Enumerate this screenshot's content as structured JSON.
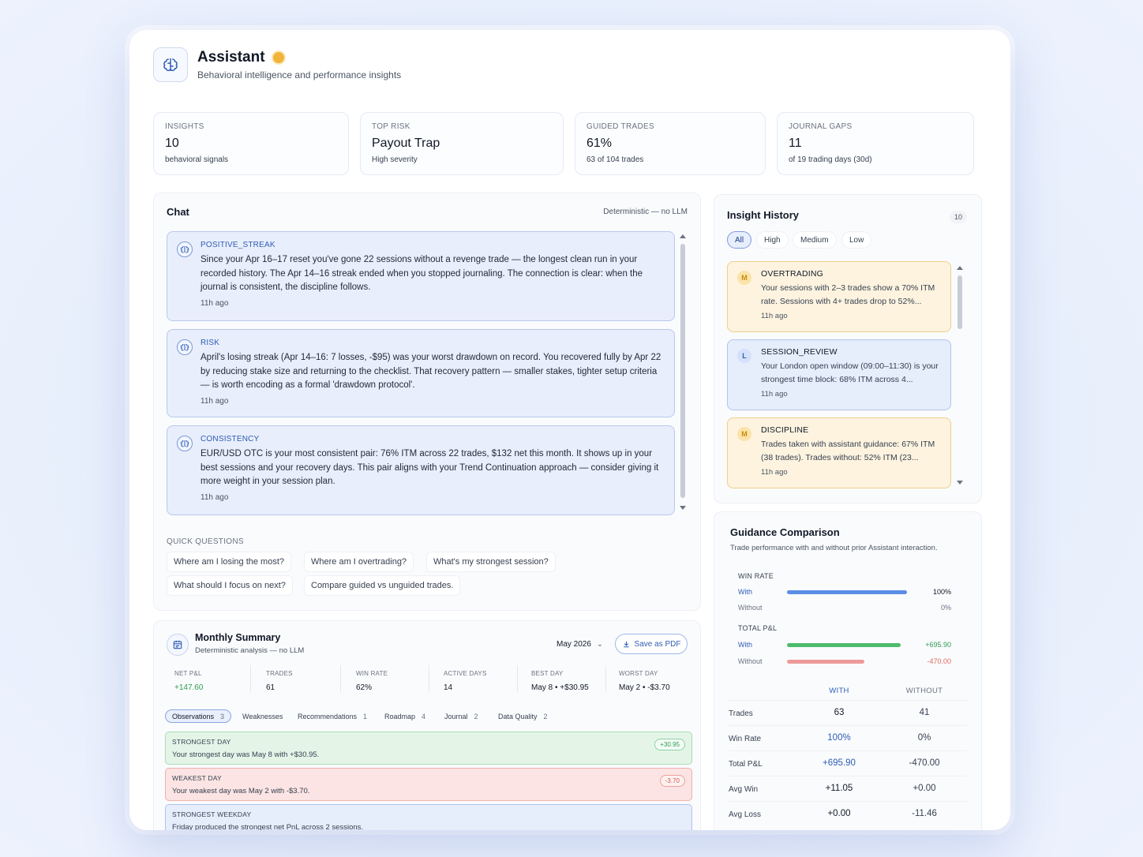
{
  "header": {
    "title": "Assistant",
    "subtitle": "Behavioral intelligence and performance insights"
  },
  "stats": [
    {
      "label": "INSIGHTS",
      "value": "10",
      "sub": "behavioral signals"
    },
    {
      "label": "TOP RISK",
      "value": "Payout Trap",
      "sub": "High severity"
    },
    {
      "label": "GUIDED TRADES",
      "value": "61%",
      "sub": "63 of 104 trades"
    },
    {
      "label": "JOURNAL GAPS",
      "value": "11",
      "sub": "of 19 trading days (30d)"
    }
  ],
  "chat": {
    "title": "Chat",
    "mode": "Deterministic — no LLM",
    "messages": [
      {
        "type": "POSITIVE_STREAK",
        "body": "Since your Apr 16–17 reset you've gone 22 sessions without a revenge trade — the longest clean run in your recorded history. The Apr 14–16 streak ended when you stopped journaling. The connection is clear: when the journal is consistent, the discipline follows.",
        "time": "11h ago"
      },
      {
        "type": "RISK",
        "body": "April's losing streak (Apr 14–16: 7 losses, -$95) was your worst drawdown on record. You recovered fully by Apr 22 by reducing stake size and returning to the checklist. That recovery pattern — smaller stakes, tighter setup criteria — is worth encoding as a formal 'drawdown protocol'.",
        "time": "11h ago"
      },
      {
        "type": "CONSISTENCY",
        "body": "EUR/USD OTC is your most consistent pair: 76% ITM across 22 trades, $132 net this month. It shows up in your best sessions and your recovery days. This pair aligns with your Trend Continuation approach — consider giving it more weight in your session plan.",
        "time": "11h ago"
      }
    ],
    "quick_title": "QUICK QUESTIONS",
    "quick_questions": [
      "Where am I losing the most?",
      "Where am I overtrading?",
      "What's my strongest session?",
      "What should I focus on next?",
      "Compare guided vs unguided trades."
    ]
  },
  "monthly": {
    "title": "Monthly Summary",
    "subtitle": "Deterministic analysis — no LLM",
    "month": "May 2026",
    "pdf_label": "Save as PDF",
    "stats": [
      {
        "label": "NET P&L",
        "value": "+147.60"
      },
      {
        "label": "TRADES",
        "value": "61"
      },
      {
        "label": "WIN RATE",
        "value": "62%"
      },
      {
        "label": "ACTIVE DAYS",
        "value": "14"
      },
      {
        "label": "BEST DAY",
        "value": "May 8 • +$30.95"
      },
      {
        "label": "WORST DAY",
        "value": "May 2 • -$3.70"
      }
    ],
    "tabs": [
      {
        "label": "Observations",
        "count": "3"
      },
      {
        "label": "Weaknesses",
        "count": ""
      },
      {
        "label": "Recommendations",
        "count": "1"
      },
      {
        "label": "Roadmap",
        "count": "4"
      },
      {
        "label": "Journal",
        "count": "2"
      },
      {
        "label": "Data Quality",
        "count": "2"
      }
    ],
    "observations": [
      {
        "title": "STRONGEST DAY",
        "body": "Your strongest day was May 8 with +$30.95.",
        "badge": "+30.95"
      },
      {
        "title": "WEAKEST DAY",
        "body": "Your weakest day was May 2 with -$3.70.",
        "badge": "-3.70"
      },
      {
        "title": "STRONGEST WEEKDAY",
        "body": "Friday produced the strongest net PnL across 2 sessions.",
        "badge": ""
      }
    ]
  },
  "history": {
    "title": "Insight History",
    "count": "10",
    "filters": [
      "All",
      "High",
      "Medium",
      "Low"
    ],
    "active_filter": "All",
    "items": [
      {
        "badge": "M",
        "title": "OVERTRADING",
        "body": "Your sessions with 2–3 trades show a 70% ITM rate. Sessions with 4+ trades drop to 52%...",
        "time": "11h ago"
      },
      {
        "badge": "L",
        "title": "SESSION_REVIEW",
        "body": "Your London open window (09:00–11:30) is your strongest time block: 68% ITM across 4...",
        "time": "11h ago"
      },
      {
        "badge": "M",
        "title": "DISCIPLINE",
        "body": "Trades taken with assistant guidance: 67% ITM (38 trades). Trades without: 52% ITM (23...",
        "time": "11h ago"
      }
    ]
  },
  "guidance": {
    "title": "Guidance Comparison",
    "subtitle": "Trade performance with and without prior Assistant interaction.",
    "win_rate": {
      "label": "WIN RATE",
      "with_label": "With",
      "without_label": "Without",
      "with_value": "100%",
      "without_value": "0%",
      "with_fraction": 1.0,
      "without_fraction": 0.0
    },
    "pnl": {
      "label": "TOTAL P&L",
      "with_label": "With",
      "without_label": "Without",
      "with_value": "+695.90",
      "without_value": "-470.00",
      "with_fraction": 1.0,
      "without_fraction": 0.68
    },
    "col_with": "WITH",
    "col_without": "WITHOUT",
    "rows": [
      {
        "label": "Trades",
        "with": "63",
        "without": "41"
      },
      {
        "label": "Win Rate",
        "with": "100%",
        "without": "0%"
      },
      {
        "label": "Total P&L",
        "with": "+695.90",
        "without": "-470.00"
      },
      {
        "label": "Avg Win",
        "with": "+11.05",
        "without": "+0.00"
      },
      {
        "label": "Avg Loss",
        "with": "+0.00",
        "without": "-11.46"
      }
    ],
    "colors": {
      "with_bar": "#5b8ee6",
      "with_pnl_bar": "#4cbb6c",
      "without_pnl_bar": "#ee9a9a",
      "accent": "#2f5db5"
    }
  }
}
